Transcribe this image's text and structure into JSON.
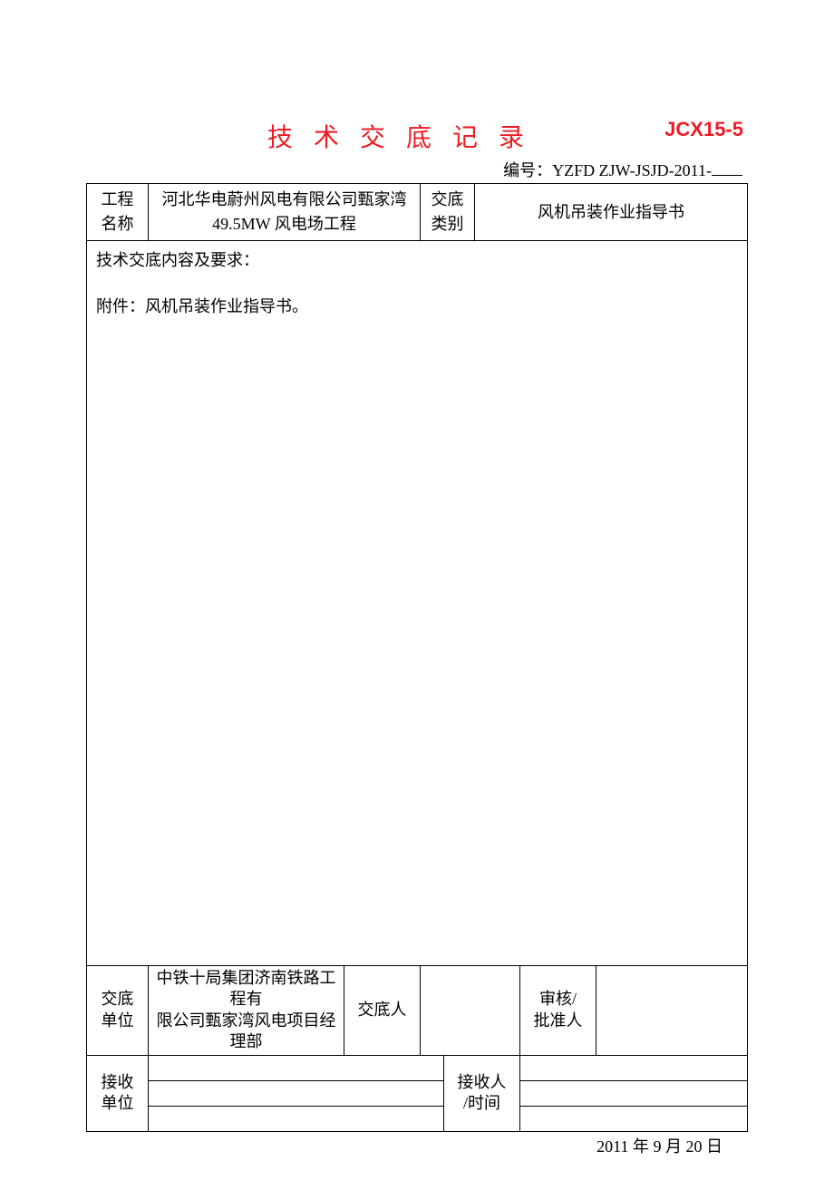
{
  "header": {
    "title": "技 术 交 底 记 录",
    "code_right": "JCX15-5",
    "serial_label": "编号：",
    "serial_value": "YZFD ZJW-JSJD-2011-"
  },
  "row1": {
    "proj_label_1": "工程",
    "proj_label_2": "名称",
    "proj_name_1": "河北华电蔚州风电有限公司甄家湾",
    "proj_name_2": "49.5MW 风电场工程",
    "cat_label_1": "交底",
    "cat_label_2": "类别",
    "cat_value": "风机吊装作业指导书"
  },
  "body": {
    "requirements_label": "技术交底内容及要求：",
    "attachment": "附件：风机吊装作业指导书。"
  },
  "footer": {
    "deliver_unit_l1": "交底",
    "deliver_unit_l2": "单位",
    "deliver_unit_val_1": "中铁十局集团济南铁路工程有",
    "deliver_unit_val_2": "限公司甄家湾风电项目经理部",
    "deliver_person": "交底人",
    "approve_l1": "审核/",
    "approve_l2": "批准人",
    "receive_unit_l1": "接收",
    "receive_unit_l2": "单位",
    "receive_person_l1": "接收人",
    "receive_person_l2": "/时间"
  },
  "date": "2011 年 9 月 20 日"
}
